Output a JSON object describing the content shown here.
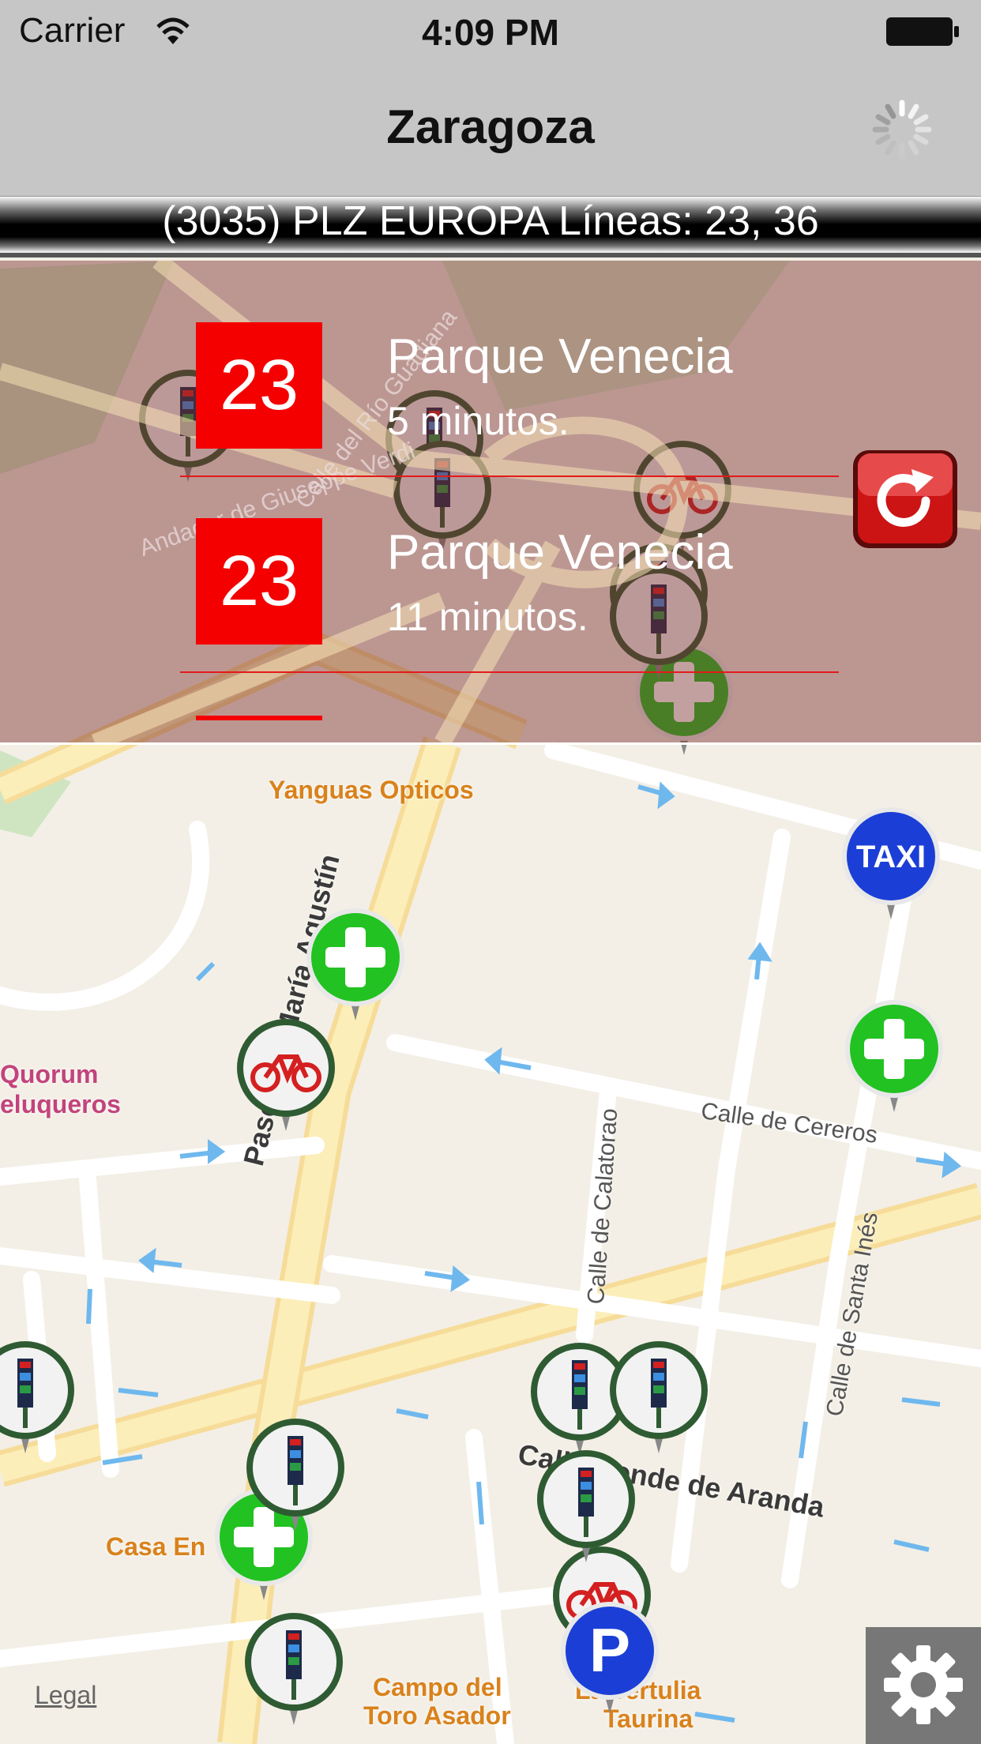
{
  "status_bar": {
    "carrier": "Carrier",
    "time": "4:09 PM"
  },
  "nav": {
    "title": "Zaragoza"
  },
  "stop": {
    "title": "(3035) PLZ EUROPA Líneas: 23, 36"
  },
  "arrivals": [
    {
      "line": "23",
      "destination": "Parque Venecia",
      "minutes": "5 minutos."
    },
    {
      "line": "23",
      "destination": "Parque Venecia",
      "minutes": "11 minutos."
    }
  ],
  "map": {
    "pois": [
      {
        "name": "Yanguas Opticos"
      },
      {
        "name": "Quorum"
      },
      {
        "name": "eluqueros"
      },
      {
        "name": "Casa En"
      },
      {
        "name": "Campo del"
      },
      {
        "name": "Toro Asador"
      },
      {
        "name": "La Tertulia"
      },
      {
        "name": "Taurina"
      }
    ],
    "streets": [
      {
        "name": "Calle del Río Guadiana"
      },
      {
        "name": "Andador de Giuseppe Verdi"
      },
      {
        "name": "Paseo de María Agustín"
      },
      {
        "name": "Calle de Cereros"
      },
      {
        "name": "Calle de Calatorao"
      },
      {
        "name": "Calle de Santa Inés"
      },
      {
        "name": "Calle Conde de Aranda"
      }
    ],
    "legal": "Legal",
    "taxi_label": "TAXI",
    "parking_label": "P"
  },
  "colors": {
    "bar_bg": "#c6c6c6",
    "line_badge": "#f40000",
    "pharmacy_green": "#22c222",
    "taxi_blue": "#1b3fd6",
    "bike_stop_ring": "#2f5b33"
  },
  "icons": {
    "refresh": "refresh-icon",
    "settings": "gear-icon",
    "spinner": "loading-spinner-icon",
    "pharmacy": "green-cross-icon",
    "bike": "bicycle-icon",
    "bus_stop": "bus-stop-sign-icon",
    "taxi": "taxi-icon",
    "parking": "parking-icon"
  }
}
